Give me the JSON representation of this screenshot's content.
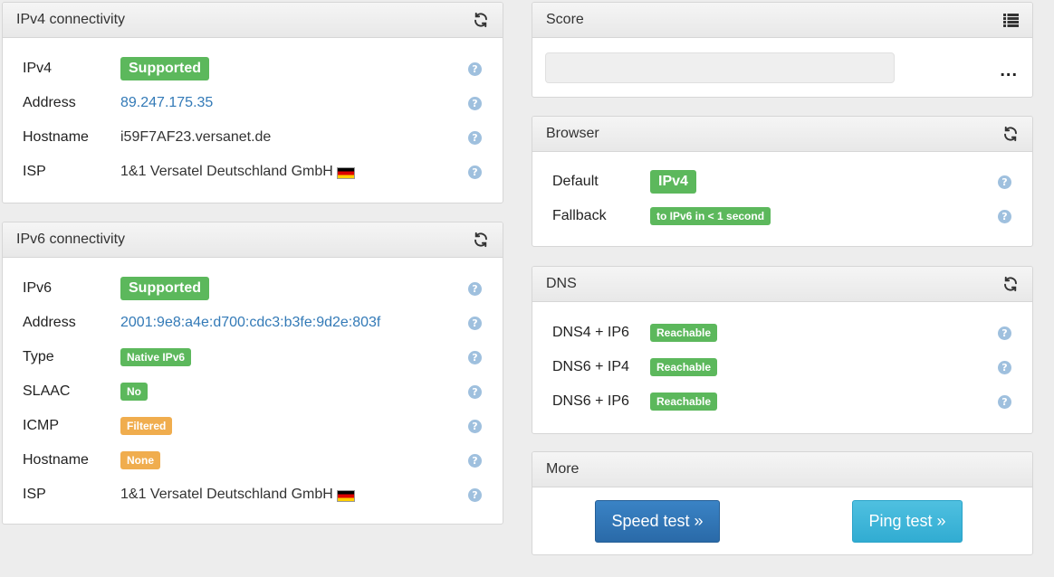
{
  "ipv4": {
    "title": "IPv4 connectivity",
    "rows": [
      {
        "label": "IPv4",
        "value": "Supported"
      },
      {
        "label": "Address",
        "value": "89.247.175.35"
      },
      {
        "label": "Hostname",
        "value": "i59F7AF23.versanet.de"
      },
      {
        "label": "ISP",
        "value": "1&1 Versatel Deutschland GmbH"
      }
    ]
  },
  "ipv6": {
    "title": "IPv6 connectivity",
    "rows": [
      {
        "label": "IPv6",
        "value": "Supported"
      },
      {
        "label": "Address",
        "value": "2001:9e8:a4e:d700:cdc3:b3fe:9d2e:803f"
      },
      {
        "label": "Type",
        "value": "Native IPv6"
      },
      {
        "label": "SLAAC",
        "value": "No"
      },
      {
        "label": "ICMP",
        "value": "Filtered"
      },
      {
        "label": "Hostname",
        "value": "None"
      },
      {
        "label": "ISP",
        "value": "1&1 Versatel Deutschland GmbH"
      }
    ]
  },
  "score": {
    "title": "Score",
    "ellipsis": "..."
  },
  "browser": {
    "title": "Browser",
    "rows": [
      {
        "label": "Default",
        "value": "IPv4"
      },
      {
        "label": "Fallback",
        "value": "to IPv6 in < 1 second"
      }
    ]
  },
  "dns": {
    "title": "DNS",
    "rows": [
      {
        "label": "DNS4 + IP6",
        "value": "Reachable"
      },
      {
        "label": "DNS6 + IP4",
        "value": "Reachable"
      },
      {
        "label": "DNS6 + IP6",
        "value": "Reachable"
      }
    ]
  },
  "more": {
    "title": "More",
    "speed_test": "Speed test »",
    "ping_test": "Ping test »"
  },
  "help_glyph": "?",
  "icons": {
    "refresh": "refresh-icon",
    "list": "list-icon",
    "flag": "germany-flag-icon",
    "help": "help-icon"
  },
  "colors": {
    "success": "#5cb85c",
    "warning": "#f0ad4e",
    "link": "#337ab7",
    "primary": "#2f73b3",
    "info": "#3bb5da"
  }
}
